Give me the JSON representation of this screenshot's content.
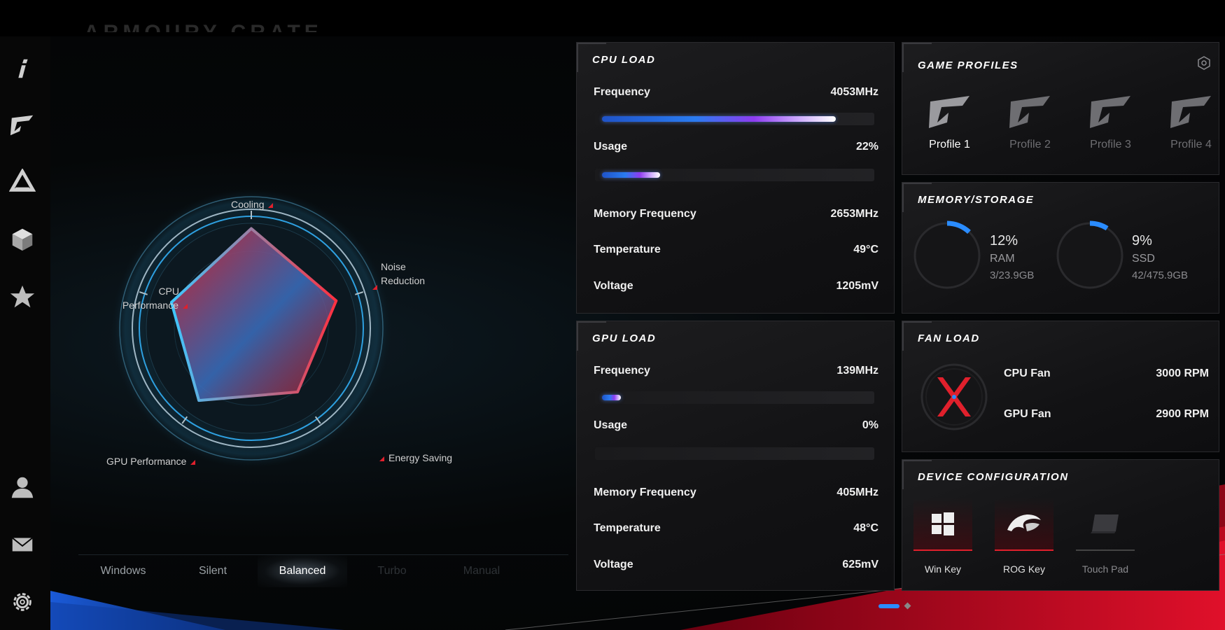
{
  "app": {
    "title_ghost": "ARMOURY CRATE"
  },
  "sidebar": {
    "items": [
      {
        "name": "info",
        "icon": "info-icon"
      },
      {
        "name": "gamevisual",
        "icon": "game-visual-icon"
      },
      {
        "name": "aura",
        "icon": "aura-icon"
      },
      {
        "name": "device",
        "icon": "cube-icon"
      },
      {
        "name": "featured",
        "icon": "star-icon"
      },
      {
        "name": "user",
        "icon": "user-icon"
      },
      {
        "name": "news",
        "icon": "mail-icon"
      },
      {
        "name": "settings",
        "icon": "gear-icon"
      }
    ]
  },
  "radar": {
    "axes": {
      "cooling": "Cooling",
      "noise_line1": "Noise",
      "noise_line2": "Reduction",
      "energy": "Energy Saving",
      "gpu": "GPU Performance",
      "cpu_line1": "CPU",
      "cpu_line2": "Performance"
    },
    "values": {
      "cooling": 0.95,
      "noise": 0.85,
      "energy": 0.75,
      "gpu": 0.85,
      "cpu": 0.8
    }
  },
  "modes": {
    "items": [
      "Windows",
      "Silent",
      "Balanced",
      "Turbo",
      "Manual"
    ],
    "active": "Balanced"
  },
  "cpu_load": {
    "title": "CPU LOAD",
    "frequency_label": "Frequency",
    "frequency_value": "4053MHz",
    "frequency_fill": 0.88,
    "usage_label": "Usage",
    "usage_value": "22%",
    "usage_fill": 0.22,
    "memfreq_label": "Memory Frequency",
    "memfreq_value": "2653MHz",
    "temp_label": "Temperature",
    "temp_value": "49°C",
    "volt_label": "Voltage",
    "volt_value": "1205mV"
  },
  "gpu_load": {
    "title": "GPU LOAD",
    "frequency_label": "Frequency",
    "frequency_value": "139MHz",
    "frequency_fill": 0.07,
    "usage_label": "Usage",
    "usage_value": "0%",
    "usage_fill": 0,
    "memfreq_label": "Memory Frequency",
    "memfreq_value": "405MHz",
    "temp_label": "Temperature",
    "temp_value": "48°C",
    "volt_label": "Voltage",
    "volt_value": "625mV"
  },
  "game_profiles": {
    "title": "GAME PROFILES",
    "items": [
      "Profile 1",
      "Profile 2",
      "Profile 3",
      "Profile 4"
    ],
    "active_index": 0
  },
  "memory_storage": {
    "title": "MEMORY/STORAGE",
    "ram": {
      "percent": "12%",
      "label": "RAM",
      "detail": "3/23.9GB",
      "fill": 0.12
    },
    "ssd": {
      "percent": "9%",
      "label": "SSD",
      "detail": "42/475.9GB",
      "fill": 0.09
    }
  },
  "fan_load": {
    "title": "FAN LOAD",
    "cpu_label": "CPU Fan",
    "cpu_value": "3000 RPM",
    "gpu_label": "GPU Fan",
    "gpu_value": "2900 RPM"
  },
  "device_config": {
    "title": "DEVICE CONFIGURATION",
    "items": [
      {
        "label": "Win Key",
        "icon": "windows-icon",
        "on": true
      },
      {
        "label": "ROG Key",
        "icon": "rog-icon",
        "on": true
      },
      {
        "label": "Touch Pad",
        "icon": "touchpad-icon",
        "on": false
      }
    ]
  },
  "colors": {
    "accent_red": "#e0202c",
    "accent_blue": "#2a7bf0"
  }
}
